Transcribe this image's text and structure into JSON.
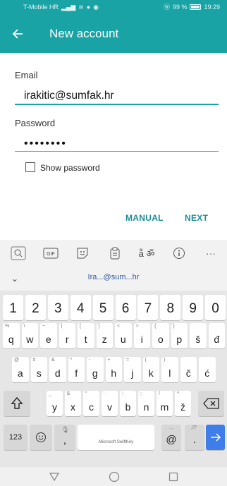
{
  "status": {
    "carrier": "T-Mobile HR",
    "battery_percent": "99 %",
    "time": "19:29"
  },
  "appbar": {
    "title": "New account"
  },
  "form": {
    "email_label": "Email",
    "email_value": "irakitic@sumfak.hr",
    "password_label": "Password",
    "password_value": "••••••••",
    "show_password_label": "Show password",
    "show_password_checked": false
  },
  "actions": {
    "manual_label": "MANUAL",
    "next_label": "NEXT"
  },
  "keyboard": {
    "suggestion": "Ira...@sum...hr",
    "numbers": [
      {
        "key": "1",
        "sub": ""
      },
      {
        "key": "2",
        "sub": ""
      },
      {
        "key": "3",
        "sub": ""
      },
      {
        "key": "4",
        "sub": ""
      },
      {
        "key": "5",
        "sub": ""
      },
      {
        "key": "6",
        "sub": ""
      },
      {
        "key": "7",
        "sub": ""
      },
      {
        "key": "8",
        "sub": ""
      },
      {
        "key": "9",
        "sub": ""
      },
      {
        "key": "0",
        "sub": ""
      }
    ],
    "row1": [
      {
        "key": "q",
        "sub": "%"
      },
      {
        "key": "w",
        "sub": "\\"
      },
      {
        "key": "e",
        "sub": "~"
      },
      {
        "key": "r",
        "sub": "|"
      },
      {
        "key": "t",
        "sub": "["
      },
      {
        "key": "z",
        "sub": "]"
      },
      {
        "key": "u",
        "sub": "<"
      },
      {
        "key": "i",
        "sub": ">"
      },
      {
        "key": "o",
        "sub": "{"
      },
      {
        "key": "p",
        "sub": "}"
      },
      {
        "key": "š",
        "sub": ""
      },
      {
        "key": "đ",
        "sub": ""
      }
    ],
    "row2": [
      {
        "key": "a",
        "sub": "@"
      },
      {
        "key": "s",
        "sub": "#"
      },
      {
        "key": "d",
        "sub": "&"
      },
      {
        "key": "f",
        "sub": "*"
      },
      {
        "key": "g",
        "sub": "-"
      },
      {
        "key": "h",
        "sub": "+"
      },
      {
        "key": "j",
        "sub": "="
      },
      {
        "key": "k",
        "sub": "("
      },
      {
        "key": "l",
        "sub": ")"
      },
      {
        "key": "č",
        "sub": ""
      },
      {
        "key": "ć",
        "sub": ""
      }
    ],
    "row3": [
      {
        "key": "y",
        "sub": "_"
      },
      {
        "key": "x",
        "sub": "$"
      },
      {
        "key": "c",
        "sub": "\""
      },
      {
        "key": "v",
        "sub": "'"
      },
      {
        "key": "b",
        "sub": ":"
      },
      {
        "key": "n",
        "sub": ";"
      },
      {
        "key": "m",
        "sub": "/"
      },
      {
        "key": "ž",
        "sub": "^"
      }
    ],
    "numbers_switch_label": "123",
    "space_label": "Microsoft SwiftKey",
    "at_label": "@",
    "period_label": ".",
    "comma_label": ","
  }
}
